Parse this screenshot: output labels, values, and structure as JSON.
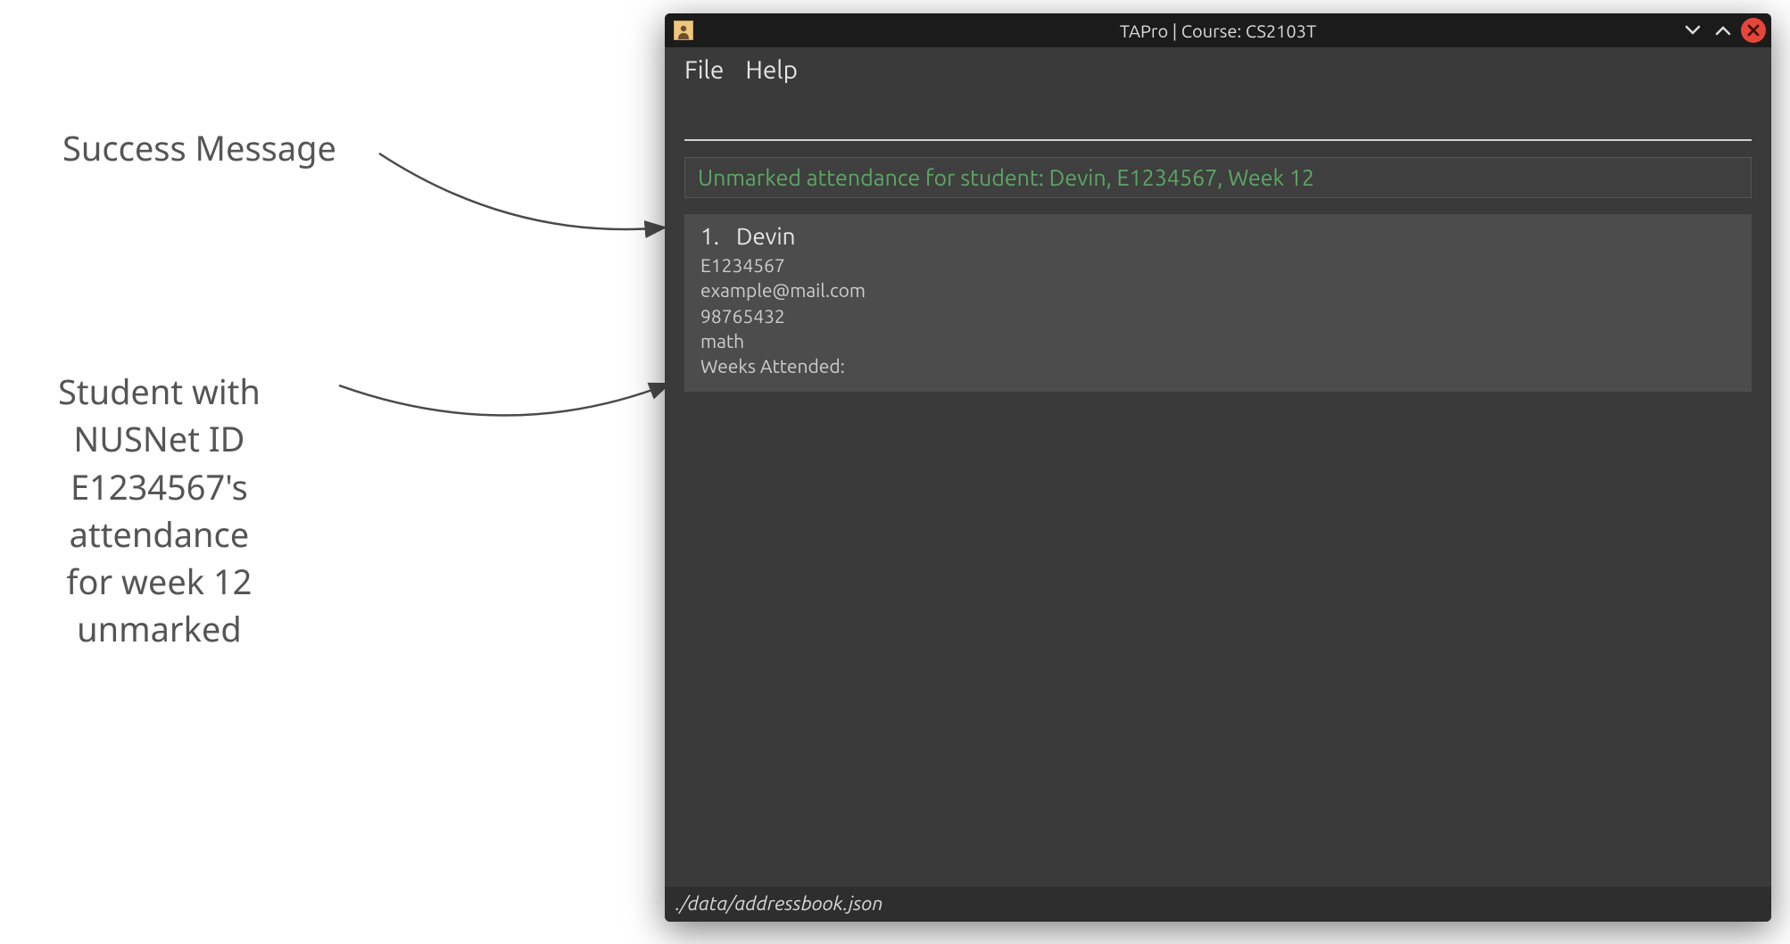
{
  "annotations": {
    "success_msg_label": "Success Message",
    "student_label": "Student with\nNUSNet ID\nE1234567's\nattendance\nfor week 12\nunmarked"
  },
  "title_bar": {
    "title": "TAPro | Course: CS2103T"
  },
  "menu": {
    "file": "File",
    "help": "Help"
  },
  "command_input": {
    "value": "",
    "placeholder": ""
  },
  "result": {
    "message": "Unmarked attendance for student: Devin, E1234567, Week 12"
  },
  "students": [
    {
      "index": "1.",
      "name": "Devin",
      "nusnet": "E1234567",
      "email": "example@mail.com",
      "phone": "98765432",
      "major": "math",
      "weeks_attended_label": "Weeks Attended:",
      "weeks_attended_value": ""
    }
  ],
  "status_bar": {
    "path": "./data/addressbook.json"
  }
}
